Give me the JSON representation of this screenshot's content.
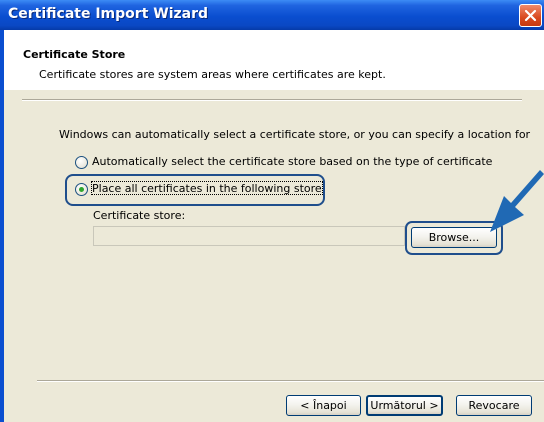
{
  "window": {
    "title": "Certificate Import Wizard"
  },
  "header": {
    "title": "Certificate Store",
    "description": "Certificate stores are system areas where certificates are kept."
  },
  "body": {
    "intro": "Windows can automatically select a certificate store, or you can specify a location for",
    "options": [
      {
        "label": "Automatically select the certificate store based on the type of certificate",
        "selected": false
      },
      {
        "label": "Place all certificates in the following store",
        "selected": true
      }
    ],
    "store_label": "Certificate store:",
    "store_value": "",
    "browse_label": "Browse..."
  },
  "footer": {
    "back_label": "< Înapoi",
    "next_label": "Următorul >",
    "cancel_label": "Revocare"
  },
  "colors": {
    "titlebar": "#0a4ed0",
    "annotation": "#1f4e8c",
    "arrow": "#2069b4",
    "radio_dot": "#2ea52e",
    "close_button": "#d9491e"
  },
  "icons": {
    "close": "close-icon",
    "annotation_arrow": "arrow-icon"
  }
}
